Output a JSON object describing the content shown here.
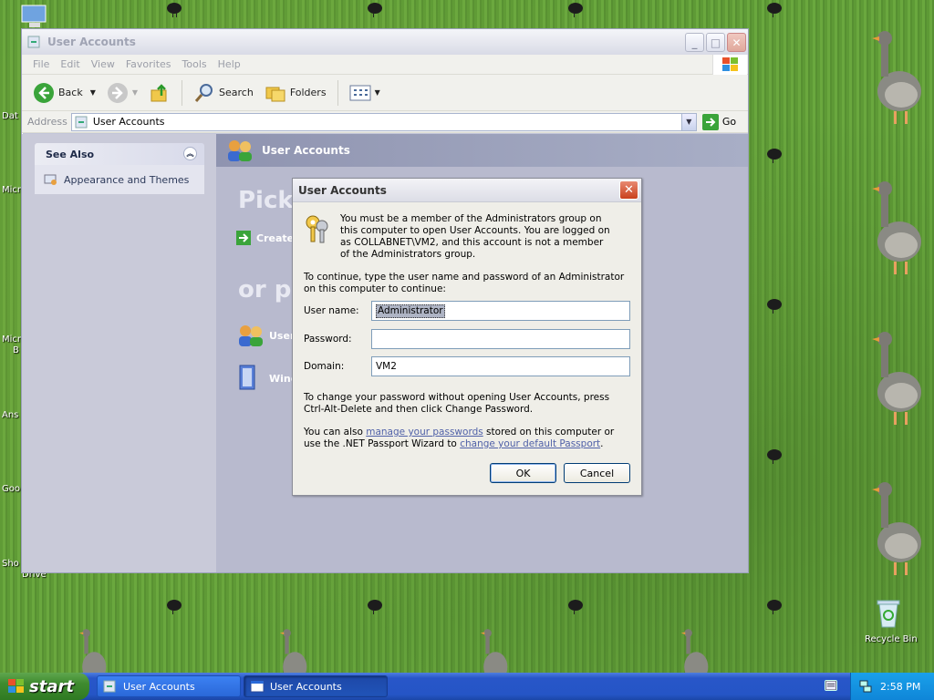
{
  "desktop": {
    "labels": [
      "Dat",
      "Micr",
      "Micr",
      "B",
      "Ans",
      "Goo",
      "Sho",
      "Drive"
    ],
    "recycle_bin": "Recycle Bin"
  },
  "window": {
    "title": "User Accounts",
    "menu": [
      "File",
      "Edit",
      "View",
      "Favorites",
      "Tools",
      "Help"
    ],
    "toolbar": {
      "back": "Back",
      "search": "Search",
      "folders": "Folders"
    },
    "address": {
      "label": "Address",
      "value": "User Accounts",
      "go": "Go"
    },
    "sidebar": {
      "header": "See Also",
      "item": "Appearance and Themes"
    },
    "main": {
      "header": "User Accounts",
      "pick": "Pick",
      "create": "Create",
      "or_pick": "or pi",
      "item1": "User",
      "item2": "Wind"
    }
  },
  "dialog": {
    "title": "User Accounts",
    "message1": "You must be a member of the Administrators group on this computer to open User Accounts.  You are logged on as COLLABNET\\VM2, and this account is not a member of the Administrators group.",
    "message2": "To continue, type the user name and password of an Administrator on this computer to continue:",
    "username_label": "User name:",
    "username_value": "Administrator",
    "password_label": "Password:",
    "password_value": "",
    "domain_label": "Domain:",
    "domain_value": "VM2",
    "message3": "To change your password without opening User Accounts, press Ctrl-Alt-Delete and then click Change Password.",
    "message4_pre": "You can also ",
    "link1": "manage your passwords",
    "message4_mid": " stored on this computer or use the .NET Passport Wizard to ",
    "link2": "change your default Passport",
    "message4_post": ".",
    "ok": "OK",
    "cancel": "Cancel"
  },
  "taskbar": {
    "start": "start",
    "items": [
      "User Accounts",
      "User Accounts"
    ],
    "clock": "2:58 PM"
  }
}
